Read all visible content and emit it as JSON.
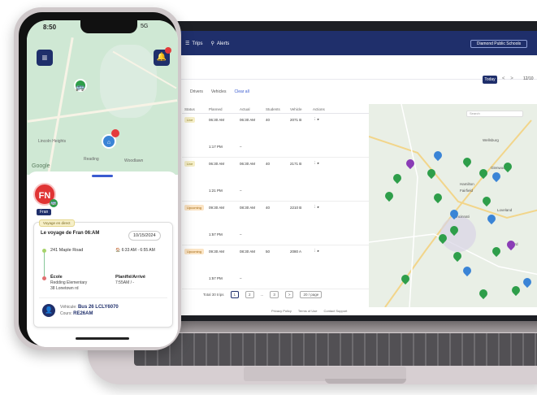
{
  "laptop": {
    "topbar": {
      "nav_items": [
        "Trips",
        "Alerts"
      ],
      "district_button": "Diamond Public Schools"
    },
    "subbar": {
      "today_label": "Today",
      "prev_arrow": "<",
      "next_arrow": ">",
      "date_label": "12/10"
    },
    "filters": [
      "Drivers",
      "Vehicles",
      "Clear all"
    ],
    "table": {
      "headers": [
        "Status",
        "Planned",
        "Actual",
        "Students",
        "Vehicle",
        "Actions"
      ],
      "trips": [
        {
          "status": "Live",
          "planned": "06:30 AM",
          "actual": "06:30 AM",
          "students": "40",
          "vehicle": "2071 B",
          "planned2": "1:17 PM",
          "actual2": "–"
        },
        {
          "status": "Live",
          "planned": "06:30 AM",
          "actual": "06:30 AM",
          "students": "40",
          "vehicle": "2171 B",
          "planned2": "1:21 PM",
          "actual2": "–"
        },
        {
          "status": "Upcoming",
          "planned": "09:30 AM",
          "actual": "08:30 AM",
          "students": "40",
          "vehicle": "2210 B",
          "planned2": "1:57 PM",
          "actual2": "–"
        },
        {
          "status": "Upcoming",
          "planned": "09:30 AM",
          "actual": "08:30 AM",
          "students": "50",
          "vehicle": "2080 A",
          "planned2": "1:57 PM",
          "actual2": "–"
        }
      ],
      "footer": {
        "rows_label": "Total 30 trips",
        "pages": [
          "1",
          "2",
          "...",
          "3",
          ">"
        ],
        "per_page": "20 / page"
      }
    },
    "app_footer": [
      "Privacy Policy",
      "Terms of Use",
      "Contact Support"
    ],
    "map": {
      "search_placeholder": "Search",
      "cities": [
        "Wellsburg",
        "Glenwood",
        "Hamilton",
        "Fairfield",
        "Cincinnati",
        "Loveland",
        "Milford"
      ]
    }
  },
  "phone": {
    "status_time": "8:50",
    "status_right": "5G",
    "menu_icon": "≡",
    "bell_icon": "🔔",
    "map_labels": [
      "Reading",
      "Lincoln Heights",
      "Woodlawn"
    ],
    "google_logo": "Google",
    "avatar_initials": "FN",
    "avatar_tag": "Fran",
    "card": {
      "live_chip": "Voyage en direct",
      "title": "Le voyage de Fran 06:AM",
      "date": "10/15/2024",
      "origin": "241 Maple Road",
      "origin_time": "6:33 AM - 6:55 AM",
      "dest_label": "École",
      "dest_name": "Redding Elementary",
      "dest_addr": "38 Lonetown rd",
      "planned_label": "Planifié/Arrivé",
      "planned_value": "7:55AM / -",
      "vehicle_prefix": "Véhicule:",
      "vehicle_value": "Bus 26 LCLY6070",
      "route_prefix": "Cours:",
      "route_value": "RE26AM"
    }
  }
}
